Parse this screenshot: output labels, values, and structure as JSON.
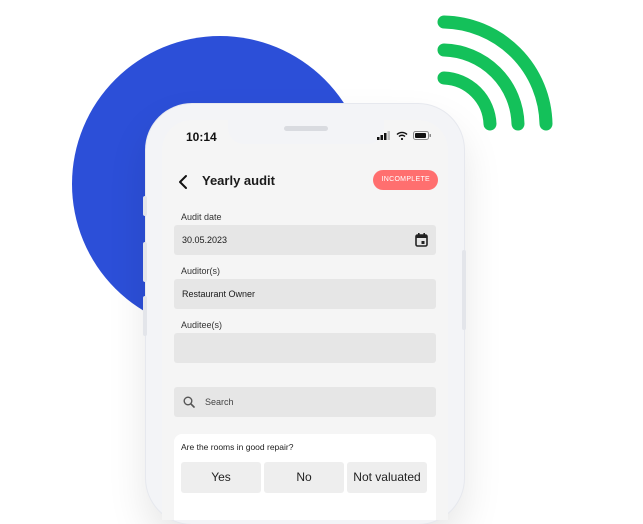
{
  "status_bar": {
    "time": "10:14"
  },
  "header": {
    "title": "Yearly audit",
    "badge": "INCOMPLETE"
  },
  "form": {
    "audit_date_label": "Audit date",
    "audit_date_value": "30.05.2023",
    "auditor_label": "Auditor(s)",
    "auditor_value": "Restaurant Owner",
    "auditee_label": "Auditee(s)",
    "auditee_value": "",
    "search_placeholder": "Search"
  },
  "question": {
    "text": "Are the rooms in good repair?",
    "options": [
      "Yes",
      "No",
      "Not valuated"
    ]
  },
  "colors": {
    "accent_blue": "#2c4fd8",
    "wifi_green": "#14c15a",
    "badge_red": "#ff6f6f"
  }
}
